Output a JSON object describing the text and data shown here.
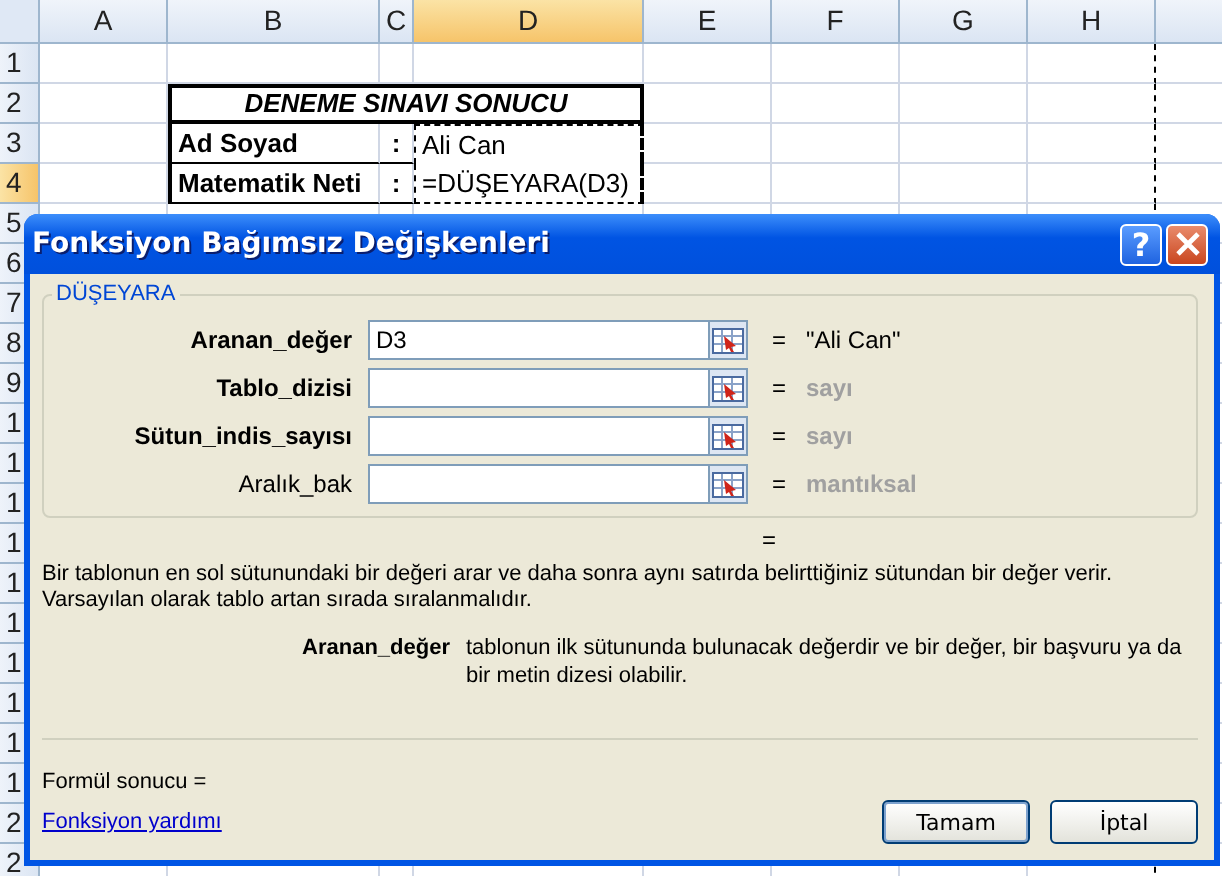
{
  "sheet": {
    "columns": [
      {
        "label": "A",
        "selected": false
      },
      {
        "label": "B",
        "selected": false
      },
      {
        "label": "C",
        "selected": false
      },
      {
        "label": "D",
        "selected": true
      },
      {
        "label": "E",
        "selected": false
      },
      {
        "label": "F",
        "selected": false
      },
      {
        "label": "G",
        "selected": false
      },
      {
        "label": "H",
        "selected": false
      }
    ],
    "rows": [
      {
        "label": "1",
        "selected": false
      },
      {
        "label": "2",
        "selected": false
      },
      {
        "label": "3",
        "selected": false
      },
      {
        "label": "4",
        "selected": true
      },
      {
        "label": "5",
        "selected": false
      },
      {
        "label": "6",
        "selected": false
      },
      {
        "label": "7",
        "selected": false
      },
      {
        "label": "8",
        "selected": false
      },
      {
        "label": "9",
        "selected": false
      },
      {
        "label": "1",
        "selected": false
      },
      {
        "label": "1",
        "selected": false
      },
      {
        "label": "1",
        "selected": false
      },
      {
        "label": "1",
        "selected": false
      },
      {
        "label": "1",
        "selected": false
      },
      {
        "label": "1",
        "selected": false
      },
      {
        "label": "1",
        "selected": false
      },
      {
        "label": "1",
        "selected": false
      },
      {
        "label": "1",
        "selected": false
      },
      {
        "label": "1",
        "selected": false
      },
      {
        "label": "2",
        "selected": false
      },
      {
        "label": "2",
        "selected": false
      }
    ],
    "table": {
      "title": "DENEME SINAVI SONUCU",
      "entries": [
        {
          "label": "Ad Soyad",
          "separator": ":",
          "value": "Ali Can",
          "marked": true
        },
        {
          "label": "Matematik Neti",
          "separator": ":",
          "value": "=DÜŞEYARA(D3)",
          "marked": true
        }
      ]
    }
  },
  "dialog": {
    "title": "Fonksiyon Bağımsız Değişkenleri",
    "help": "?",
    "function_name": "DÜŞEYARA",
    "arguments": [
      {
        "label": "Aranan_değer",
        "required": true,
        "value": "D3",
        "equals": "=",
        "result": "\"Ali Can\"",
        "dimmed": false
      },
      {
        "label": "Tablo_dizisi",
        "required": true,
        "equals": "=",
        "result": "sayı",
        "dimmed": true
      },
      {
        "label": "Sütun_indis_sayısı",
        "required": true,
        "equals": "=",
        "result": "sayı",
        "dimmed": true
      },
      {
        "label": "Aralık_bak",
        "required": false,
        "equals": "=",
        "result": "mantıksal",
        "dimmed": true
      }
    ],
    "overall_result": "=",
    "description": "Bir tablonun en sol sütunundaki bir değeri arar ve daha sonra aynı satırda belirttiğiniz sütundan bir değer verir. Varsayılan olarak tablo artan sırada sıralanmalıdır.",
    "help_argument": {
      "name": "Aranan_değer",
      "text": "tablonun ilk sütununda bulunacak değerdir ve bir değer, bir başvuru ya da bir metin dizesi olabilir."
    },
    "formula_result": "Formül sonucu =",
    "help_link": "Fonksiyon yardımı",
    "buttons": [
      "Tamam",
      "İptal"
    ]
  }
}
